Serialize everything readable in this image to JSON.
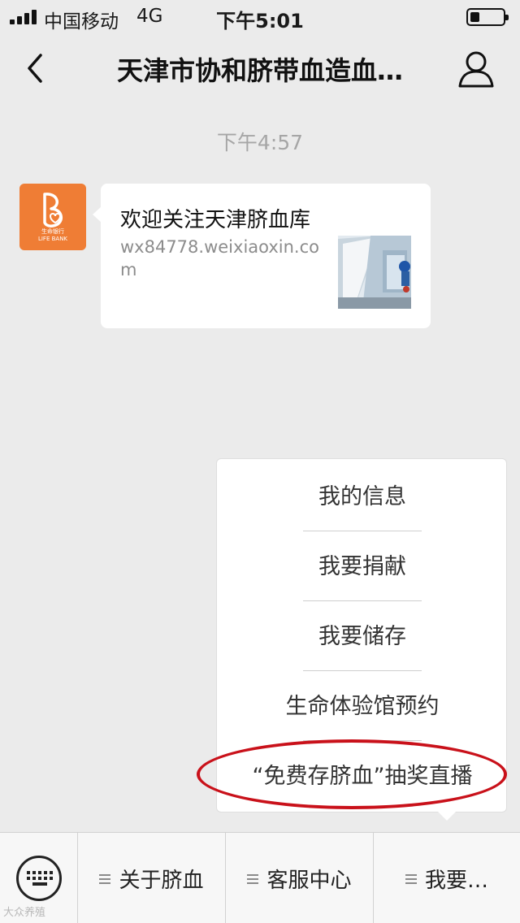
{
  "status_bar": {
    "carrier": "中国移动",
    "network": "4G",
    "time": "下午5:01",
    "battery_level": 0.3
  },
  "nav": {
    "title": "天津市协和脐带血造血…",
    "back_icon": "chevron-left-icon",
    "profile_icon": "person-icon"
  },
  "chat": {
    "timestamp": "下午4:57",
    "message": {
      "avatar_icon": "life-bank-logo",
      "avatar_caption": "生命银行",
      "avatar_caption_en": "LIFE BANK",
      "title": "欢迎关注天津脐血库",
      "description": "wx84778.weixiaoxin.com",
      "thumbnail": "lab-photo-thumbnail"
    }
  },
  "menu_popup": {
    "items": [
      {
        "label": "我的信息"
      },
      {
        "label": "我要捐献"
      },
      {
        "label": "我要储存"
      },
      {
        "label": "生命体验馆预约"
      },
      {
        "label": "“免费存脐血”抽奖直播"
      }
    ],
    "highlight_color": "#c9111a"
  },
  "bottom_menu": {
    "keyboard_icon": "keyboard-icon",
    "tabs": [
      {
        "label": "关于脐血"
      },
      {
        "label": "客服中心"
      },
      {
        "label": "我要…"
      }
    ]
  },
  "watermark": "大众养殖"
}
